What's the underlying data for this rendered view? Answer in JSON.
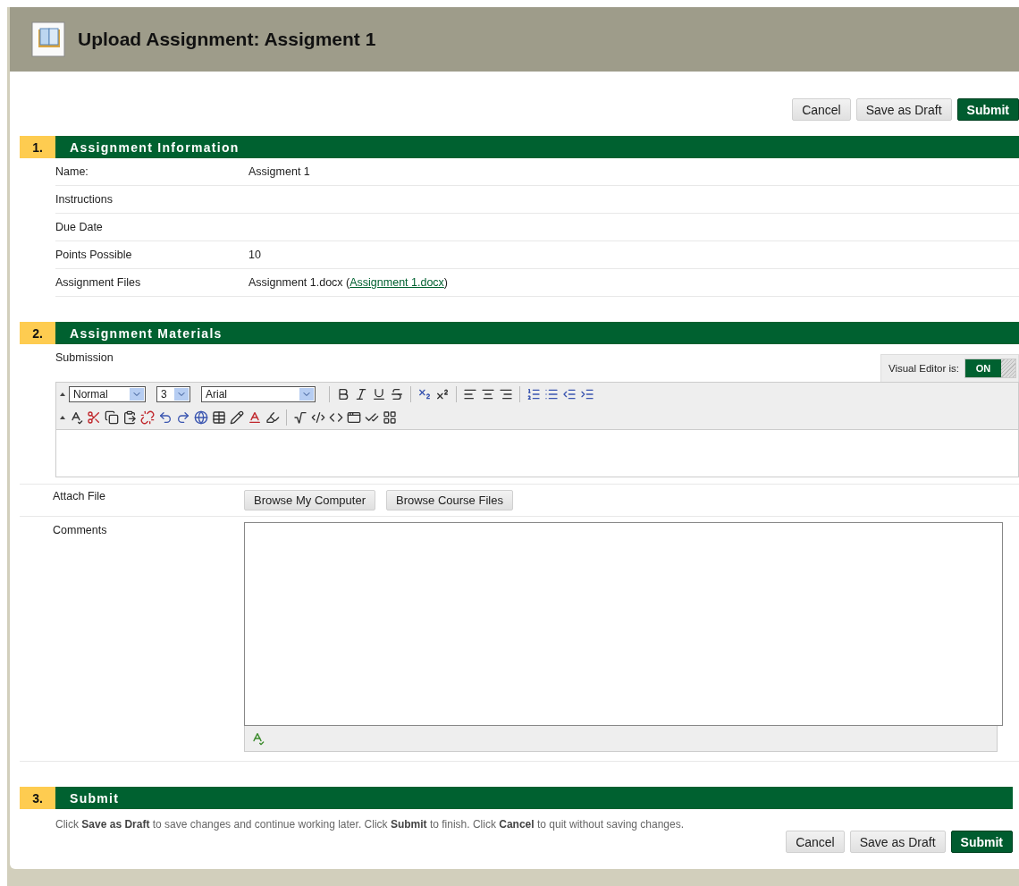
{
  "header": {
    "title": "Upload Assignment: Assigment 1"
  },
  "top_actions": [
    {
      "label": "Cancel",
      "kind": "secondary"
    },
    {
      "label": "Save as Draft",
      "kind": "secondary"
    },
    {
      "label": "Submit",
      "kind": "primary"
    }
  ],
  "info_section": {
    "number": "1.",
    "title": "Assignment Information",
    "rows": [
      {
        "label": "Name:",
        "value": "Assigment 1"
      },
      {
        "label": "Instructions"
      },
      {
        "label": "Due Date"
      },
      {
        "label": "Points Possible",
        "value": "10"
      },
      {
        "label": "Assignment Files",
        "value": "Assignment 1.docx (",
        "link": "Assignment 1.docx",
        "suffix": ")"
      }
    ]
  },
  "materials_section": {
    "number": "2.",
    "title": "Assignment Materials",
    "submission_label": "Submission",
    "visual_editor": {
      "label": "Visual Editor is:",
      "state_label": "ON",
      "on": true
    },
    "toolbar": {
      "format": "Normal",
      "size": "3",
      "font": "Arial"
    },
    "attach_label": "Attach File",
    "attach_buttons": [
      "Browse My Computer",
      "Browse Course Files"
    ],
    "comments_label": "Comments"
  },
  "submit_section": {
    "number": "3.",
    "title": "Submit",
    "instructions": "Click **Save as Draft** to save changes and continue working later. Click **Submit** to finish. Click **Cancel** to quit without saving changes.",
    "actions": [
      {
        "label": "Cancel",
        "kind": "secondary"
      },
      {
        "label": "Save as Draft",
        "kind": "secondary"
      },
      {
        "label": "Submit",
        "kind": "primary"
      }
    ]
  }
}
